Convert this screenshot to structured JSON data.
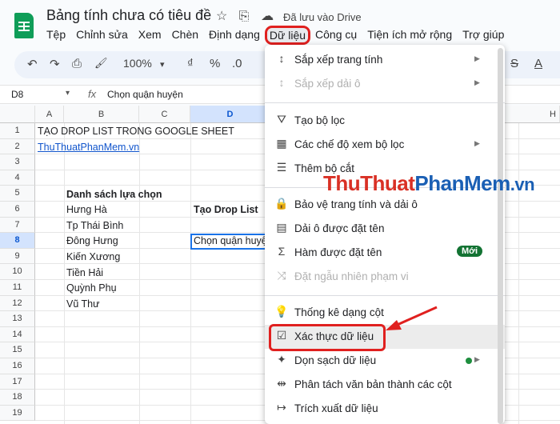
{
  "doc": {
    "title": "Bảng tính chưa có tiêu đề",
    "saved_status": "Đã lưu vào Drive",
    "star_icon": "☆",
    "folder_icon": "⎘",
    "cloud_icon": "☁"
  },
  "menubar": [
    "Tệp",
    "Chỉnh sửa",
    "Xem",
    "Chèn",
    "Định dạng",
    "Dữ liệu",
    "Công cụ",
    "Tiện ích mở rộng",
    "Trợ giúp"
  ],
  "toolbar": {
    "undo": "↶",
    "redo": "↷",
    "print": "⎙",
    "paint": "🖌",
    "zoom": "100%",
    "zoom_arrow": "▾",
    "currency": "₫",
    "percent": "%",
    "decimal": ".0",
    "strike": "S",
    "textcolor": "A"
  },
  "formula_bar": {
    "cell_ref": "D8",
    "arrow": "▾",
    "fx": "fx",
    "value": "Chọn quận huyện"
  },
  "columns": [
    "A",
    "B",
    "C",
    "D",
    "H"
  ],
  "rows": [
    "1",
    "2",
    "3",
    "4",
    "5",
    "6",
    "7",
    "8",
    "9",
    "10",
    "11",
    "12",
    "13",
    "14",
    "15",
    "16",
    "17",
    "18",
    "19"
  ],
  "cells": {
    "a1": "TẠO DROP LIST TRONG GOOGLE SHEET",
    "a2": "ThuThuatPhanMem.vn",
    "b5": "Danh sách lựa chọn",
    "b6": "Hưng Hà",
    "b7": "Tp Thái Bình",
    "b8": "Đông Hưng",
    "b9": "Kiến Xương",
    "b10": "Tiền Hải",
    "b11": "Quỳnh Phụ",
    "b12": "Vũ Thư",
    "d6": "Tạo Drop List",
    "d8": "Chọn quận huyệ"
  },
  "menu": {
    "items": [
      {
        "icon": "↕",
        "label": "Sắp xếp trang tính",
        "sub": "▶"
      },
      {
        "icon": "↕",
        "label": "Sắp xếp dải ô",
        "sub": "▶"
      },
      {
        "icon": "⛛",
        "label": "Tạo bộ lọc"
      },
      {
        "icon": "▦",
        "label": "Các chế độ xem bộ lọc",
        "sub": "▶"
      },
      {
        "icon": "☰",
        "label": "Thêm bộ cắt"
      },
      {
        "icon": "🔒",
        "label": "Bảo vệ trang tính và dải ô"
      },
      {
        "icon": "▤",
        "label": "Dải ô được đặt tên"
      },
      {
        "icon": "Σ",
        "label": "Hàm được đặt tên",
        "badge": "Mới"
      },
      {
        "icon": "⤨",
        "label": "Đặt ngẫu nhiên phạm vi"
      },
      {
        "icon": "💡",
        "label": "Thống kê dạng cột"
      },
      {
        "icon": "☑",
        "label": "Xác thực dữ liệu"
      },
      {
        "icon": "✦",
        "label": "Dọn sạch dữ liệu",
        "sub": "▶"
      },
      {
        "icon": "⇹",
        "label": "Phân tách văn bản thành các cột"
      },
      {
        "icon": "↦",
        "label": "Trích xuất dữ liệu"
      }
    ]
  },
  "watermark": {
    "part1": "ThuThuat",
    "part2": "PhanMem",
    "part3": ".vn"
  },
  "colors": {
    "highlight_red": "#e0201f",
    "sheets_green": "#0f9d58",
    "select_blue": "#1a73e8"
  }
}
